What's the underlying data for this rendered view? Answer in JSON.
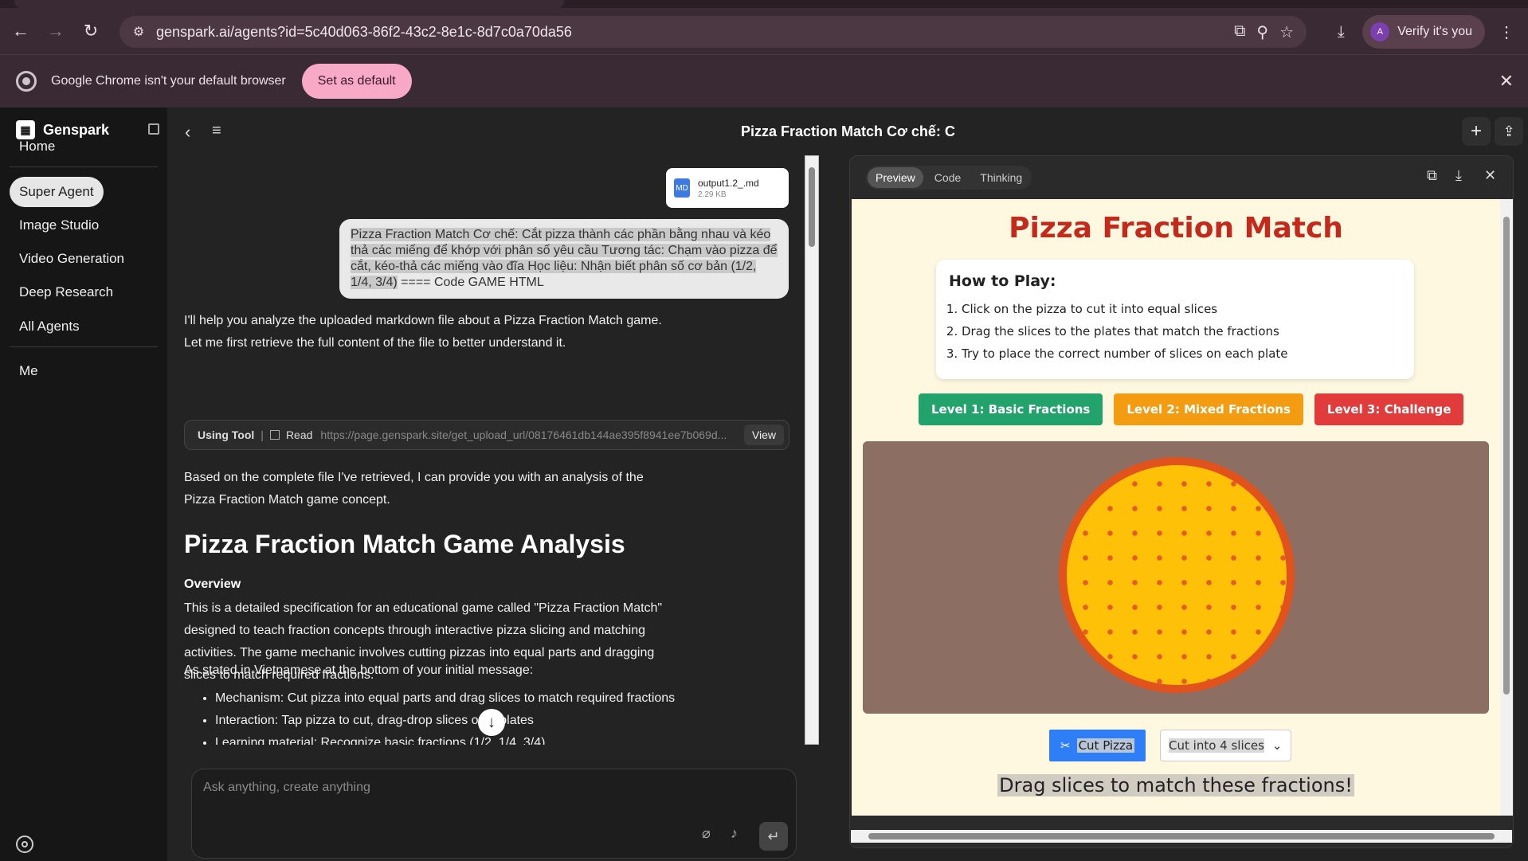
{
  "browser": {
    "url": "genspark.ai/agents?id=5c40d063-86f2-43c2-8e1c-8d7c0a70da56",
    "verify_label": "Verify it's you",
    "avatar_letter": "A"
  },
  "infobar": {
    "message": "Google Chrome isn't your default browser",
    "set_default": "Set as default"
  },
  "sidebar": {
    "brand": "Genspark",
    "items": [
      {
        "label": "Home"
      },
      {
        "label": "Super Agent"
      },
      {
        "label": "Image Studio"
      },
      {
        "label": "Video Generation"
      },
      {
        "label": "Deep Research"
      },
      {
        "label": "All Agents"
      },
      {
        "label": "Me"
      }
    ]
  },
  "header": {
    "title": "Pizza Fraction Match Cơ chế: C"
  },
  "chat": {
    "file": {
      "name": "output1.2_.md",
      "size": "2.29 KB"
    },
    "user_message": "Pizza Fraction Match Cơ chế: Cắt pizza thành các phần bằng nhau và kéo thả các miếng để khớp với phân số yêu cầu Tương tác: Chạm vào pizza để cắt, kéo-thả các miếng vào đĩa Học liệu: Nhận biết phân số cơ bản (1/2, 1/4, 3/4)",
    "user_message_tail": " ==== Code GAME HTML",
    "p1": "I'll help you analyze the uploaded markdown file about a Pizza Fraction Match game. Let me first retrieve the full content of the file to better understand it.",
    "tool": {
      "using": "Using Tool",
      "sep": "|",
      "read": "Read",
      "url": "https://page.genspark.site/get_upload_url/08176461db144ae395f8941ee7b069d...",
      "view": "View"
    },
    "p2": "Based on the complete file I've retrieved, I can provide you with an analysis of the Pizza Fraction Match game concept.",
    "h1": "Pizza Fraction Match Game Analysis",
    "h3": "Overview",
    "p3": "This is a detailed specification for an educational game called \"Pizza Fraction Match\" designed to teach fraction concepts through interactive pizza slicing and matching activities. The game mechanic involves cutting pizzas into equal parts and dragging slices to match required fractions.",
    "p4": "As stated in Vietnamese at the bottom of your initial message:",
    "bullets": [
      "Mechanism: Cut pizza into equal parts and drag slices to match required fractions",
      "Interaction: Tap pizza to cut, drag-drop slices onto plates",
      "Learning material: Recognize basic fractions (1/2, 1/4, 3/4)"
    ],
    "placeholder": "Ask anything, create anything"
  },
  "panel": {
    "tabs": [
      "Preview",
      "Code",
      "Thinking"
    ],
    "game": {
      "title": "Pizza Fraction Match",
      "howto_title": "How to Play:",
      "steps": [
        "Click on the pizza to cut it into equal slices",
        "Drag the slices to the plates that match the fractions",
        "Try to place the correct number of slices on each plate"
      ],
      "levels": [
        "Level 1: Basic Fractions",
        "Level 2: Mixed Fractions",
        "Level 3: Challenge"
      ],
      "cut_button": "Cut Pizza",
      "cut_select": "Cut into 4 slices",
      "drag_message": "Drag slices to match these fractions!"
    }
  }
}
